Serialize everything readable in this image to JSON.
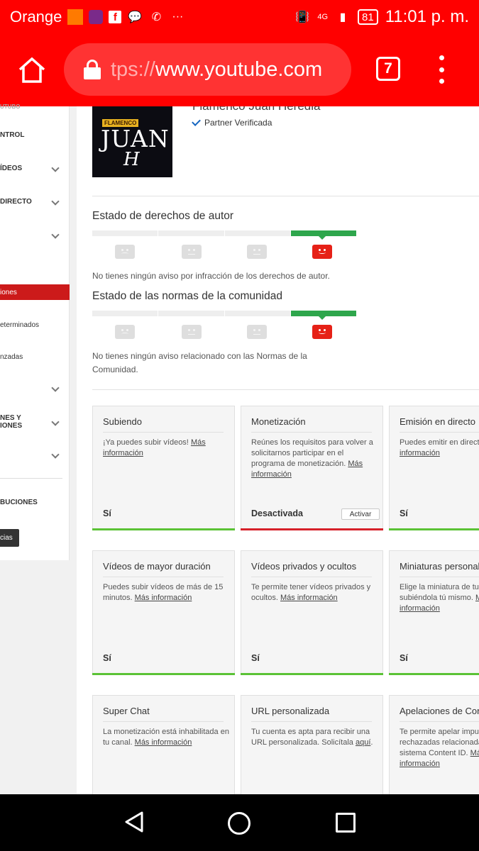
{
  "status_bar": {
    "carrier": "Orange",
    "network": "4G",
    "battery": "81",
    "time": "11:01 p. m."
  },
  "browser": {
    "url_faded": "tps://",
    "url_main": "www.youtube.com",
    "tab_count": "7"
  },
  "sidebar": {
    "items": [
      {
        "label": "NTROL"
      },
      {
        "label": "ÍDEOS"
      },
      {
        "label": "DIRECTO"
      },
      {
        "label": "iones"
      },
      {
        "label": "eterminados"
      },
      {
        "label": "nzadas"
      },
      {
        "label": "NES Y\nIONES"
      },
      {
        "label": "BUCIONES"
      }
    ],
    "button_label": "cias"
  },
  "channel": {
    "name": "Flamenco Juan Heredia",
    "verified": "Partner Verificada",
    "thumb_tag": "FLAMENCO",
    "thumb_big": "JUAN",
    "thumb_h": "H"
  },
  "copyright": {
    "title": "Estado de derechos de autor",
    "note": "No tienes ningún aviso por infracción de los derechos de autor."
  },
  "community": {
    "title": "Estado de las normas de la comunidad",
    "note": "No tienes ningún aviso relacionado con las Normas de la Comunidad."
  },
  "cards": [
    {
      "title": "Subiendo",
      "desc": "¡Ya puedes subir vídeos!",
      "link": "Más información",
      "status": "Sí"
    },
    {
      "title": "Monetización",
      "desc": "Reúnes los requisitos para volver a solicitarnos participar en el programa de monetización.",
      "link": "Más información",
      "status": "Desactivada",
      "button": "Activar"
    },
    {
      "title": "Emisión en directo",
      "desc": "Puedes emitir en directo.",
      "link": "Más información",
      "status": "Sí"
    },
    {
      "title": "Vídeos de mayor duración",
      "desc": "Puedes subir vídeos de más de 15 minutos.",
      "link": "Más información",
      "status": "Sí"
    },
    {
      "title": "Vídeos privados y ocultos",
      "desc": "Te permite tener vídeos privados y ocultos.",
      "link": "Más información",
      "status": "Sí"
    },
    {
      "title": "Miniaturas personalizadas",
      "desc": "Elige la miniatura de tu vídeo subiéndola tú mismo.",
      "link": "Más información",
      "status": "Sí"
    },
    {
      "title": "Super Chat",
      "desc": "La monetización está inhabilitada en tu canal.",
      "link": "Más información",
      "status": ""
    },
    {
      "title": "URL personalizada",
      "desc": "Tu cuenta es apta para recibir una URL personalizada. Solicítala",
      "link": "aquí",
      "suffix": ".",
      "status": ""
    },
    {
      "title": "Apelaciones de Content ID",
      "desc": "Te permite apelar impugnaciones rechazadas relacionadas con el sistema Content ID.",
      "link": "Más información",
      "status": ""
    }
  ],
  "colors": {
    "accent": "#ff0000",
    "ok": "#2ea64c",
    "bad": "#d6212a"
  }
}
